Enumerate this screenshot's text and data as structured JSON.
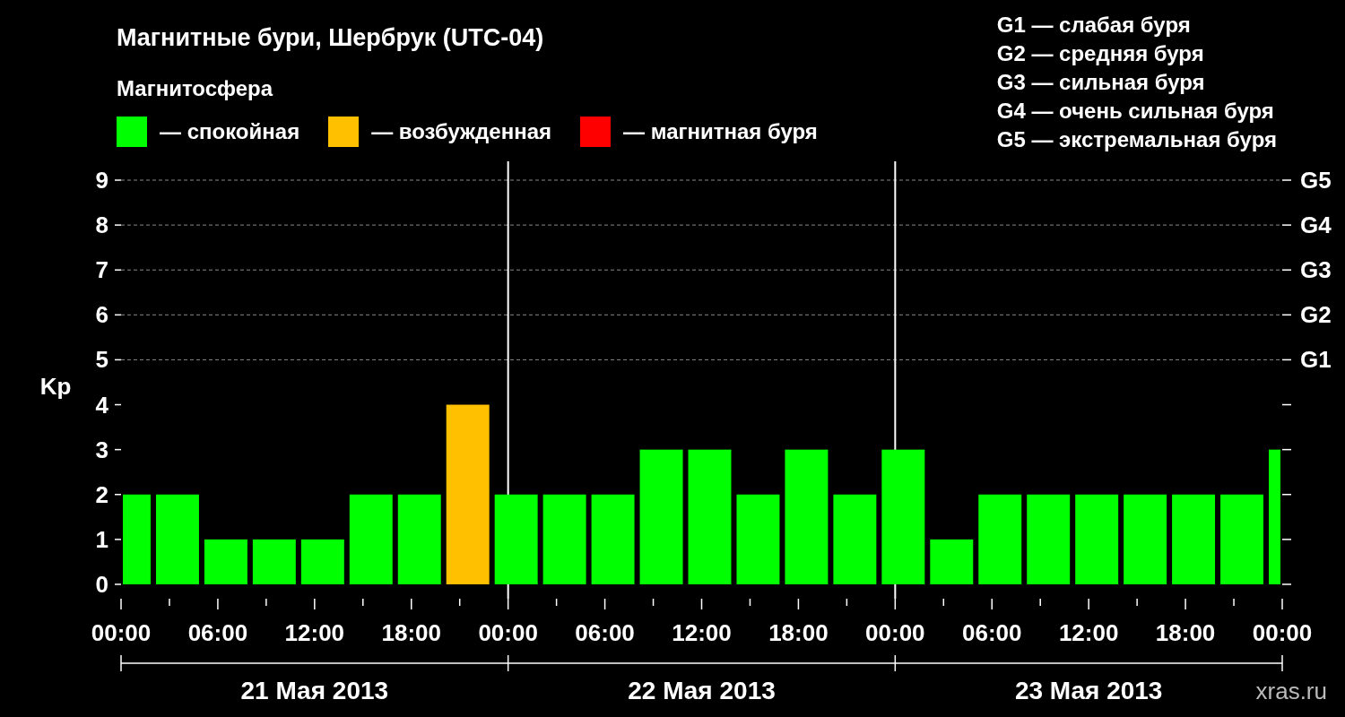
{
  "title": "Магнитные бури, Шербрук (UTC-04)",
  "legend": {
    "title": "Магнитосфера",
    "dashes": [
      "—",
      "—",
      "—"
    ]
  },
  "storm_scale": [
    "G1 — слабая буря",
    "G2 — средняя буря",
    "G3 — сильная буря",
    "G4 — очень сильная буря",
    "G5 — экстремальная буря"
  ],
  "chart": {
    "right_axis_labels": [
      "G5",
      "G4",
      "G3",
      "G2",
      "G1"
    ],
    "days": [
      "21 Мая 2013",
      "22 Мая 2013",
      "23 Мая 2013"
    ],
    "chart_data": {
      "type": "bar",
      "ylabel": "Kp",
      "grid": true,
      "x": [
        "2013-05-21 01:00",
        "2013-05-21 03:30",
        "2013-05-21 06:30",
        "2013-05-21 09:30",
        "2013-05-21 12:30",
        "2013-05-21 15:30",
        "2013-05-21 18:30",
        "2013-05-21 21:30",
        "2013-05-22 00:30",
        "2013-05-22 03:30",
        "2013-05-22 06:30",
        "2013-05-22 09:30",
        "2013-05-22 12:30",
        "2013-05-22 15:30",
        "2013-05-22 18:30",
        "2013-05-22 21:30",
        "2013-05-23 00:30",
        "2013-05-23 03:30",
        "2013-05-23 06:30",
        "2013-05-23 09:30",
        "2013-05-23 12:30",
        "2013-05-23 15:30",
        "2013-05-23 18:30",
        "2013-05-23 21:30",
        "2013-05-23 23:45"
      ],
      "xlim": [
        "2013-05-21 00:00",
        "2013-05-24 00:00"
      ],
      "ylim": [
        -0.32,
        9
      ],
      "xticks": [
        {
          "value": "2013-05-21 00:00",
          "label": "00:00"
        },
        {
          "value": "2013-05-21 06:00",
          "label": "06:00"
        },
        {
          "value": "2013-05-21 12:00",
          "label": "12:00"
        },
        {
          "value": "2013-05-21 18:00",
          "label": "18:00"
        },
        {
          "value": "2013-05-22 00:00",
          "label": "00:00"
        },
        {
          "value": "2013-05-22 06:00",
          "label": "06:00"
        },
        {
          "value": "2013-05-22 12:00",
          "label": "12:00"
        },
        {
          "value": "2013-05-22 18:00",
          "label": "18:00"
        },
        {
          "value": "2013-05-23 00:00",
          "label": "00:00"
        },
        {
          "value": "2013-05-23 06:00",
          "label": "06:00"
        },
        {
          "value": "2013-05-23 12:00",
          "label": "12:00"
        },
        {
          "value": "2013-05-23 18:00",
          "label": "18:00"
        },
        {
          "value": "2013-05-24 00:00",
          "label": "00:00"
        }
      ],
      "yticks": [
        0,
        1,
        2,
        3,
        4,
        5,
        6,
        7,
        8,
        9
      ],
      "series": [
        {
          "name": "спокойная",
          "color": "#00ff00",
          "values": [
            2,
            2,
            1,
            1,
            1,
            2,
            2,
            null,
            2,
            2,
            2,
            3,
            3,
            2,
            3,
            2,
            3,
            1,
            2,
            2,
            2,
            2,
            2,
            2,
            3
          ]
        },
        {
          "name": "возбужденная",
          "color": "#ffc000",
          "values": [
            null,
            null,
            null,
            null,
            null,
            null,
            null,
            4,
            null,
            null,
            null,
            null,
            null,
            null,
            null,
            null,
            null,
            null,
            null,
            null,
            null,
            null,
            null,
            null,
            null
          ]
        },
        {
          "name": "магнитная буря",
          "color": "#ff0000",
          "values": [
            null,
            null,
            null,
            null,
            null,
            null,
            null,
            null,
            null,
            null,
            null,
            null,
            null,
            null,
            null,
            null,
            null,
            null,
            null,
            null,
            null,
            null,
            null,
            null,
            null
          ]
        }
      ]
    }
  },
  "credit": "xras.ru"
}
